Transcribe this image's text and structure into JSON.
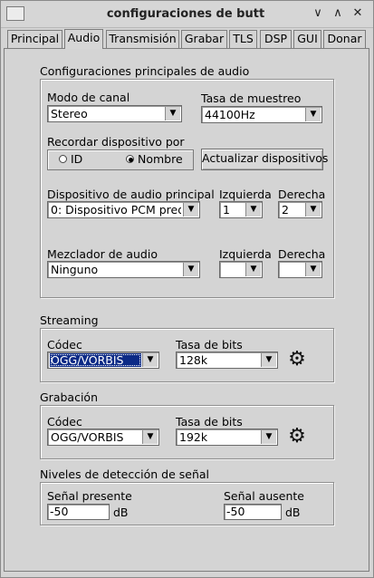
{
  "window": {
    "title": "configuraciones de butt",
    "controls": {
      "minimize": "∨",
      "maximize": "∧",
      "restore": "−",
      "close": "✕"
    }
  },
  "tabs": [
    {
      "label": "Principal",
      "active": false
    },
    {
      "label": "Audio",
      "active": true
    },
    {
      "label": "Transmisión",
      "active": false
    },
    {
      "label": "Grabar",
      "active": false
    },
    {
      "label": "TLS",
      "active": false
    },
    {
      "label": "DSP",
      "active": false
    },
    {
      "label": "GUI",
      "active": false
    },
    {
      "label": "Donar",
      "active": false
    }
  ],
  "audio_main": {
    "group_label": "Configuraciones principales de audio",
    "channel_mode": {
      "label": "Modo de canal",
      "value": "Stereo"
    },
    "sample_rate": {
      "label": "Tasa de muestreo",
      "value": "44100Hz"
    },
    "remember_device": {
      "label": "Recordar dispositivo por",
      "option_id": "ID",
      "option_name": "Nombre",
      "selected": "Nombre"
    },
    "refresh_button": "Actualizar dispositivos",
    "main_device": {
      "label": "Dispositivo de audio principal",
      "value": "0: Dispositivo PCM prede",
      "left_label": "Izquierda",
      "left_value": "1",
      "right_label": "Derecha",
      "right_value": "2"
    },
    "mixer": {
      "label": "Mezclador de audio",
      "value": "Ninguno",
      "left_label": "Izquierda",
      "left_value": "",
      "right_label": "Derecha",
      "right_value": ""
    }
  },
  "streaming": {
    "group_label": "Streaming",
    "codec_label": "Códec",
    "codec_value": "OGG/VORBIS",
    "bitrate_label": "Tasa de bits",
    "bitrate_value": "128k"
  },
  "recording": {
    "group_label": "Grabación",
    "codec_label": "Códec",
    "codec_value": "OGG/VORBIS",
    "bitrate_label": "Tasa de bits",
    "bitrate_value": "192k"
  },
  "signal": {
    "group_label": "Niveles de detección de señal",
    "present_label": "Señal presente",
    "present_value": "-50",
    "present_unit": "dB",
    "absent_label": "Señal ausente",
    "absent_value": "-50",
    "absent_unit": "dB"
  }
}
